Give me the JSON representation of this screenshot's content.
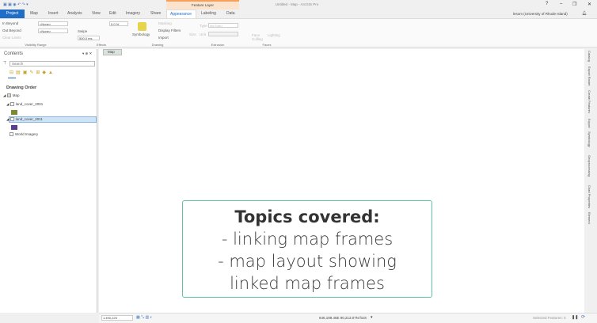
{
  "window": {
    "title": "Untitled - Map - ArcGIS Pro",
    "context_tab": "Feature Layer",
    "help": "?",
    "minimize": "–",
    "restore": "❐",
    "close": "✕",
    "user": "lesom (University of Rhode Island)"
  },
  "tabs": [
    {
      "label": "Project"
    },
    {
      "label": "Map"
    },
    {
      "label": "Insert"
    },
    {
      "label": "Analysis"
    },
    {
      "label": "View"
    },
    {
      "label": "Edit"
    },
    {
      "label": "Imagery"
    },
    {
      "label": "Share"
    },
    {
      "label": "Appearance",
      "active": true
    },
    {
      "label": "Labeling"
    },
    {
      "label": "Data"
    }
  ],
  "ribbon": {
    "visibility": {
      "in_beyond": "In Beyond",
      "out_beyond": "Out Beyond",
      "clear_limits": "Clear Limits",
      "min_value": "<None>",
      "max_value": "<None>",
      "group": "Visibility Range"
    },
    "effects": {
      "transparency": "0.0 %",
      "swipe": "Swipe",
      "flicker": "500.0 ms",
      "group": "Effects"
    },
    "drawing": {
      "symbology": "Symbology",
      "masking": "Masking",
      "display_filters": "Display Filters",
      "import": "Import",
      "group": "Drawing"
    },
    "extrusion": {
      "type_label": "Type",
      "type_value": "No Extru",
      "unit_label": "Unit",
      "size": "Size",
      "group": "Extrusion"
    },
    "faces": {
      "face_culling": "Face Culling",
      "lighting": "Lighting",
      "group": "Faces"
    }
  },
  "contents": {
    "title": "Contents",
    "search_placeholder": "Search",
    "heading": "Drawing Order",
    "layers": [
      {
        "name": "Map"
      },
      {
        "name": "land_cover_2001",
        "swatch": "#7a8a2e"
      },
      {
        "name": "land_cover_2011",
        "swatch": "#5a3d8f",
        "selected": true
      },
      {
        "name": "World Imagery"
      }
    ]
  },
  "map_tab": "Map",
  "textbox": {
    "heading": "Topics covered:",
    "lines": [
      "- linking map frames",
      "- map layout showing",
      "linked map frames"
    ],
    "border_color": "#5fc3a0"
  },
  "right_panes": [
    "Catalog",
    "Export Raster",
    "Create Features",
    "Export",
    "Symbology",
    "Geoprocessing",
    "Chart Properties",
    "Element"
  ],
  "status": {
    "scale": "1:490,225",
    "coordinates": "646,199.46E 90,213.07N ftUS",
    "selected_features": "Selected Features: 0"
  }
}
